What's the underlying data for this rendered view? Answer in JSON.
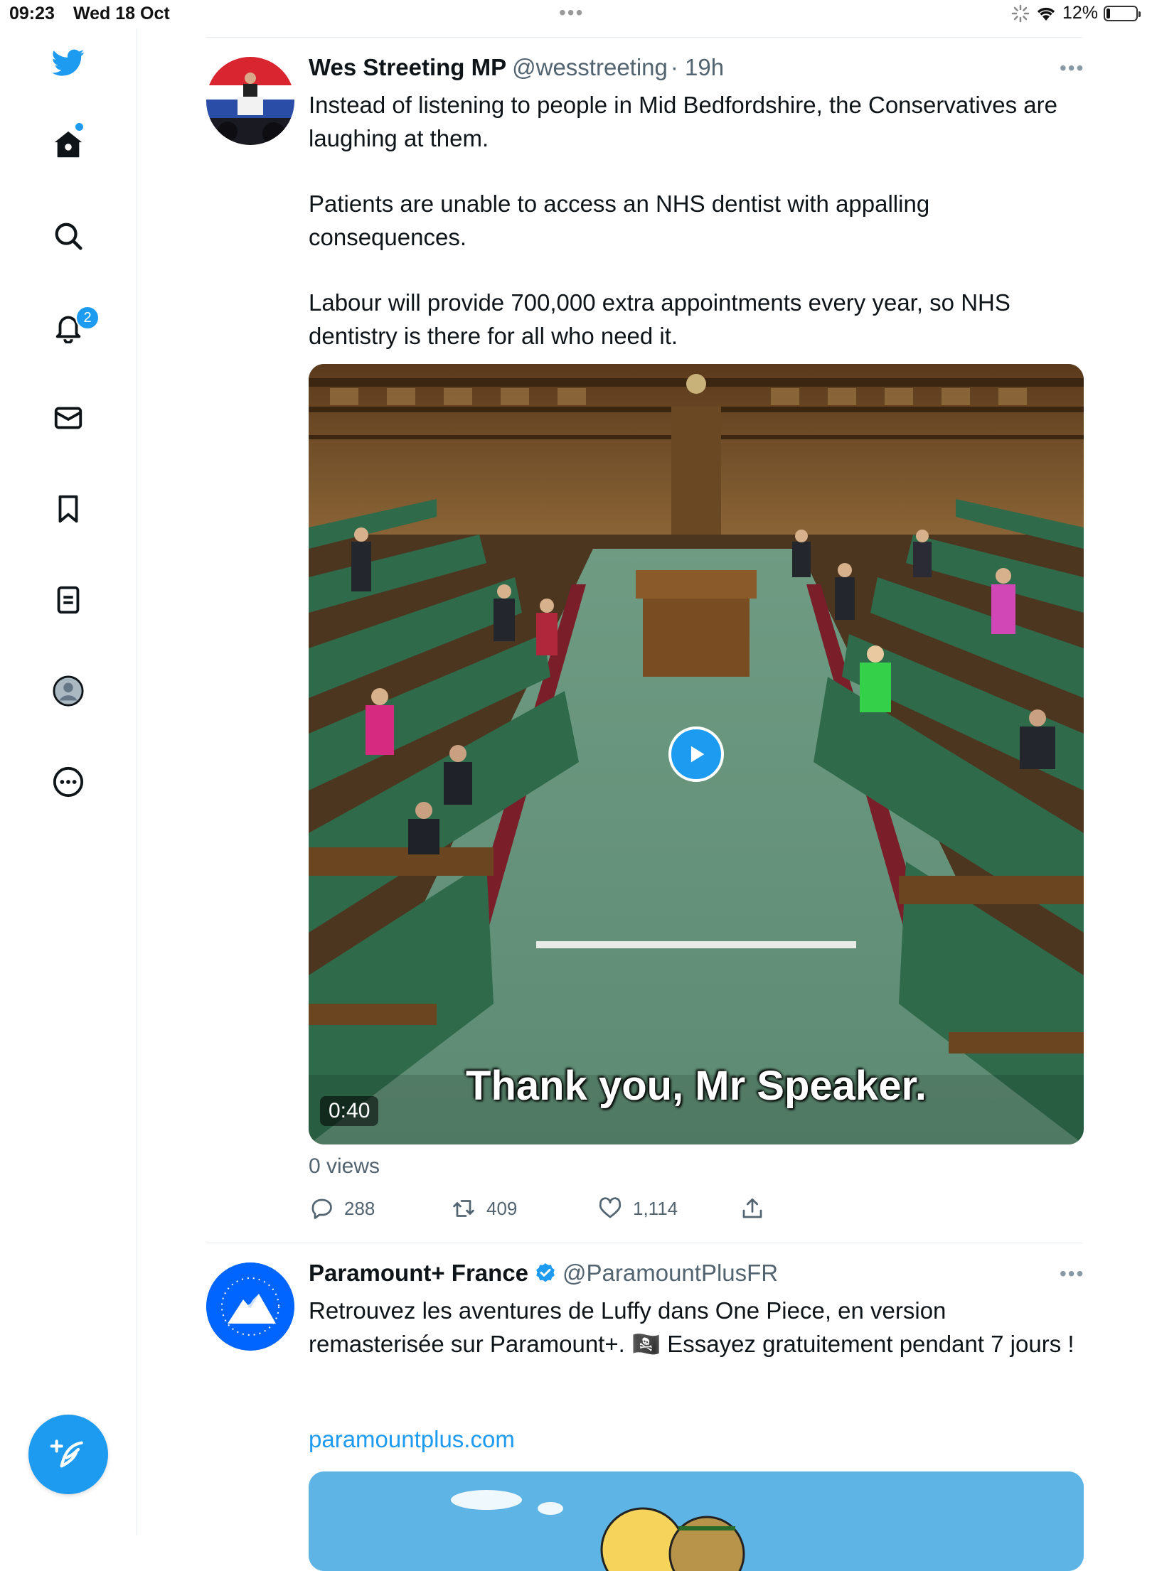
{
  "status_bar": {
    "time": "09:23",
    "date": "Wed 18 Oct",
    "battery_percent": "12%",
    "battery_level": 0.12
  },
  "sidebar": {
    "items": [
      {
        "name": "twitter-logo",
        "icon": "bird-icon"
      },
      {
        "name": "home",
        "icon": "home-icon"
      },
      {
        "name": "explore",
        "icon": "search-icon"
      },
      {
        "name": "notifications",
        "icon": "bell-icon",
        "badge": "2"
      },
      {
        "name": "messages",
        "icon": "mail-icon"
      },
      {
        "name": "bookmarks",
        "icon": "bookmark-icon"
      },
      {
        "name": "lists",
        "icon": "list-icon"
      },
      {
        "name": "profile",
        "icon": "avatar-icon"
      },
      {
        "name": "more",
        "icon": "more-icon"
      }
    ],
    "compose_icon": "compose-icon",
    "accent": "#1d9bf0"
  },
  "tweets": [
    {
      "name": "Wes Streeting MP",
      "handle": "@wesstreeting",
      "time": "· 19h",
      "paragraphs": [
        "Instead of listening to people in Mid Bedfordshire, the Conservatives are laughing at them.",
        "Patients are unable to access an NHS dentist with appalling consequences.",
        "Labour will provide 700,000 extra appointments every year, so NHS dentistry is there for all who need it."
      ],
      "video": {
        "subtitle": "Thank you, Mr Speaker.",
        "duration": "0:40"
      },
      "views": "0 views",
      "replies": "288",
      "retweets": "409",
      "likes": "1,114"
    },
    {
      "name": "Paramount+ France",
      "handle": "@ParamountPlusFR",
      "verified": true,
      "paragraphs": [
        "Retrouvez les aventures de Luffy dans One Piece, en version remasterisée sur Paramount+. 🏴‍☠️ Essayez gratuitement pendant 7 jours !"
      ],
      "link": "paramountplus.com"
    }
  ]
}
